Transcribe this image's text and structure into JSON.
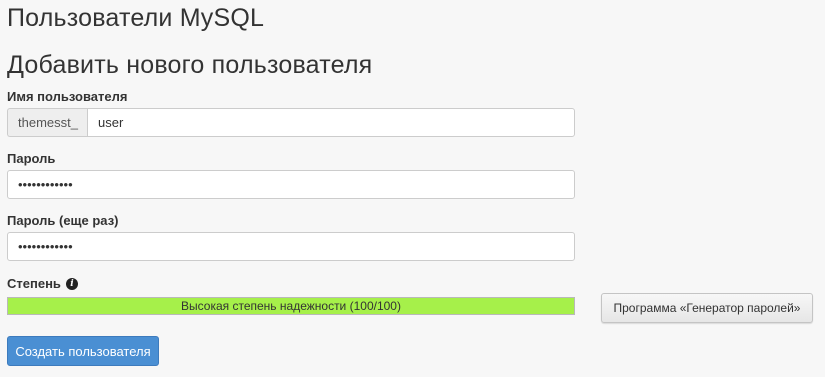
{
  "page": {
    "title": "Пользователи MySQL"
  },
  "form": {
    "title": "Добавить нового пользователя",
    "username": {
      "label": "Имя пользователя",
      "prefix": "themesst_",
      "value": "user"
    },
    "password": {
      "label": "Пароль",
      "value": "••••••••••••"
    },
    "password_repeat": {
      "label": "Пароль (еще раз)",
      "value": "••••••••••••"
    },
    "strength": {
      "label": "Степень",
      "info_icon": "info-icon",
      "text": "Высокая степень надежности (100/100)",
      "score": 100,
      "max": 100,
      "color": "#a6f04a"
    },
    "generator_button": "Программа «Генератор паролей»",
    "create_button": "Создать пользователя"
  },
  "colors": {
    "primary": "#4a8fd3",
    "strength_fill": "#a6f04a"
  }
}
